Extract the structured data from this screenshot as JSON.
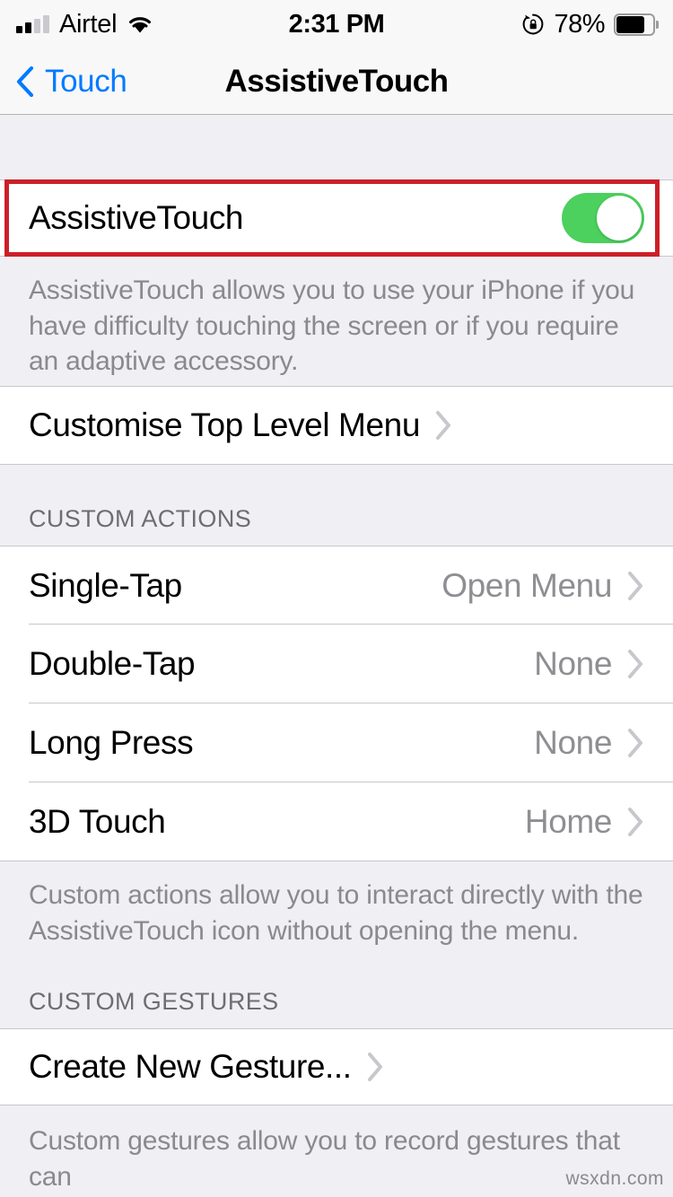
{
  "status_bar": {
    "carrier": "Airtel",
    "signal_bars_total": 4,
    "signal_bars_filled": 2,
    "wifi_icon": "wifi-icon",
    "time": "2:31 PM",
    "rotation_lock_icon": "rotation-lock-icon",
    "battery_percent": "78%",
    "battery_level": 78
  },
  "nav_bar": {
    "back_label": "Touch",
    "back_icon": "chevron-left-icon",
    "title": "AssistiveTouch"
  },
  "main": {
    "assistive_touch": {
      "label": "AssistiveTouch",
      "toggle_state": "on",
      "toggle_color": "#4cd05e",
      "footer": "AssistiveTouch allows you to use your iPhone if you have difficulty touching the screen or if you require an adaptive accessory."
    },
    "customise_menu": {
      "label": "Customise Top Level Menu",
      "chevron_icon": "chevron-right-icon"
    },
    "custom_actions": {
      "header": "CUSTOM ACTIONS",
      "rows": [
        {
          "label": "Single-Tap",
          "value": "Open Menu",
          "chevron_icon": "chevron-right-icon"
        },
        {
          "label": "Double-Tap",
          "value": "None",
          "chevron_icon": "chevron-right-icon"
        },
        {
          "label": "Long Press",
          "value": "None",
          "chevron_icon": "chevron-right-icon"
        },
        {
          "label": "3D Touch",
          "value": "Home",
          "chevron_icon": "chevron-right-icon"
        }
      ],
      "footer": "Custom actions allow you to interact directly with the AssistiveTouch icon without opening the menu."
    },
    "custom_gestures": {
      "header": "CUSTOM GESTURES",
      "rows": [
        {
          "label": "Create New Gesture...",
          "chevron_icon": "chevron-right-icon"
        }
      ],
      "footer": "Custom gestures allow you to record gestures that can"
    }
  },
  "watermark": "wsxdn.com",
  "colors": {
    "accent_blue": "#007aff",
    "toggle_green": "#4cd05e",
    "highlight_red": "#cc1f28",
    "group_bg": "#efeff4",
    "secondary_text": "#8e8e93"
  }
}
